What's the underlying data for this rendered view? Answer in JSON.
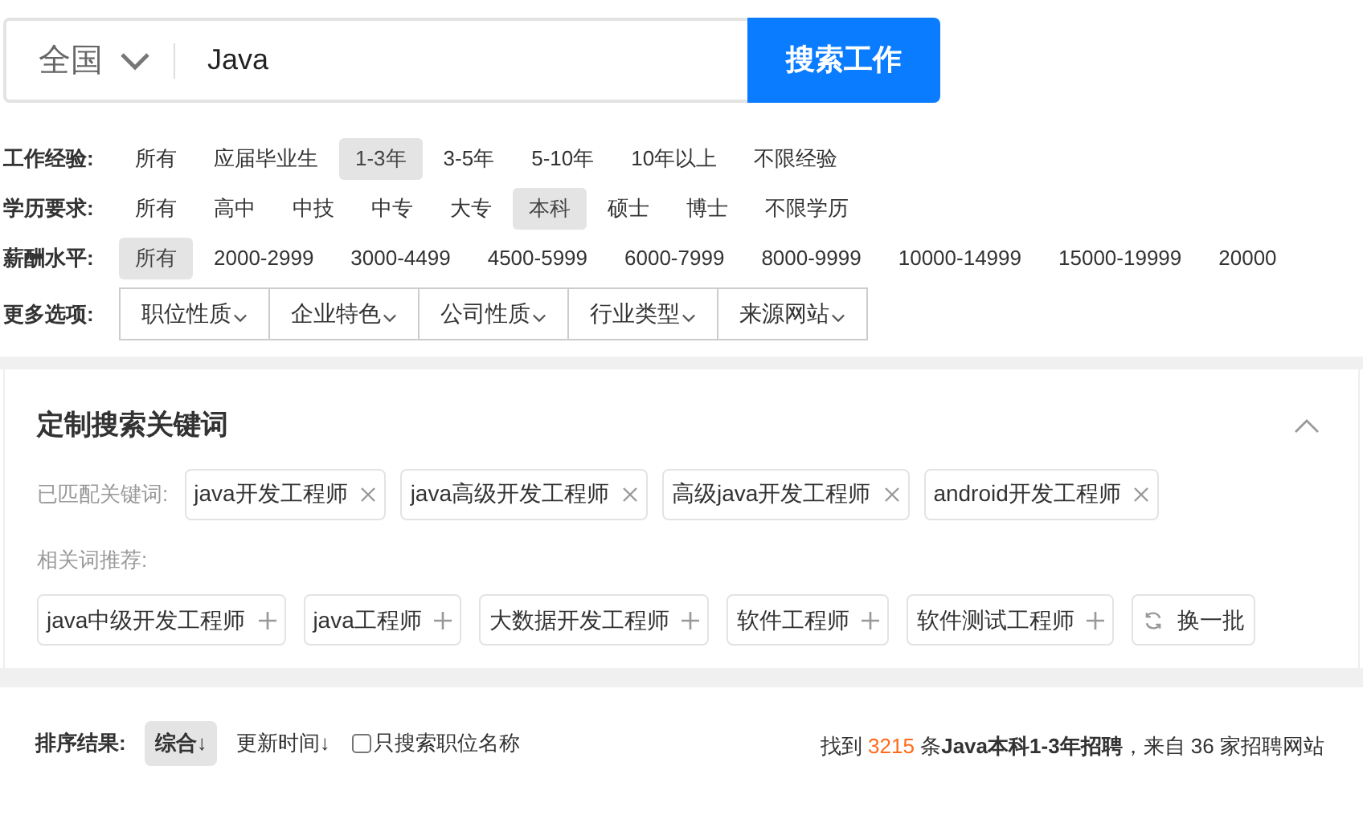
{
  "search": {
    "city": "全国",
    "query": "Java",
    "button": "搜索工作"
  },
  "filters": [
    {
      "label": "工作经验:",
      "options": [
        {
          "label": "所有",
          "selected": false
        },
        {
          "label": "应届毕业生",
          "selected": false
        },
        {
          "label": "1-3年",
          "selected": true
        },
        {
          "label": "3-5年",
          "selected": false
        },
        {
          "label": "5-10年",
          "selected": false
        },
        {
          "label": "10年以上",
          "selected": false
        },
        {
          "label": "不限经验",
          "selected": false
        }
      ]
    },
    {
      "label": "学历要求:",
      "options": [
        {
          "label": "所有",
          "selected": false
        },
        {
          "label": "高中",
          "selected": false
        },
        {
          "label": "中技",
          "selected": false
        },
        {
          "label": "中专",
          "selected": false
        },
        {
          "label": "大专",
          "selected": false
        },
        {
          "label": "本科",
          "selected": true
        },
        {
          "label": "硕士",
          "selected": false
        },
        {
          "label": "博士",
          "selected": false
        },
        {
          "label": "不限学历",
          "selected": false
        }
      ]
    },
    {
      "label": "薪酬水平:",
      "options": [
        {
          "label": "所有",
          "selected": true
        },
        {
          "label": "2000-2999",
          "selected": false
        },
        {
          "label": "3000-4499",
          "selected": false
        },
        {
          "label": "4500-5999",
          "selected": false
        },
        {
          "label": "6000-7999",
          "selected": false
        },
        {
          "label": "8000-9999",
          "selected": false
        },
        {
          "label": "10000-14999",
          "selected": false
        },
        {
          "label": "15000-19999",
          "selected": false
        },
        {
          "label": "20000",
          "selected": false
        }
      ]
    }
  ],
  "more_options": {
    "label": "更多选项:",
    "dropdowns": [
      "职位性质",
      "企业特色",
      "公司性质",
      "行业类型",
      "来源网站"
    ]
  },
  "keywords": {
    "title": "定制搜索关键词",
    "expanded": true,
    "matched_label": "已匹配关键词:",
    "matched": [
      "java开发工程师",
      "java高级开发工程师",
      "高级java开发工程师",
      "android开发工程师"
    ],
    "related_label": "相关词推荐:",
    "related": [
      "java中级开发工程师",
      "java工程师",
      "大数据开发工程师",
      "软件工程师",
      "软件测试工程师"
    ],
    "refresh": "换一批"
  },
  "results": {
    "sort_label": "排序结果:",
    "sort_options": [
      {
        "label": "综合↓",
        "selected": true
      },
      {
        "label": "更新时间↓",
        "selected": false
      }
    ],
    "title_only": {
      "label": "只搜索职位名称",
      "checked": false
    },
    "summary": {
      "prefix": "找到",
      "count": "3215",
      "rest": "条**Java本科1-3年招聘**，来自 36 家招聘网站"
    }
  }
}
